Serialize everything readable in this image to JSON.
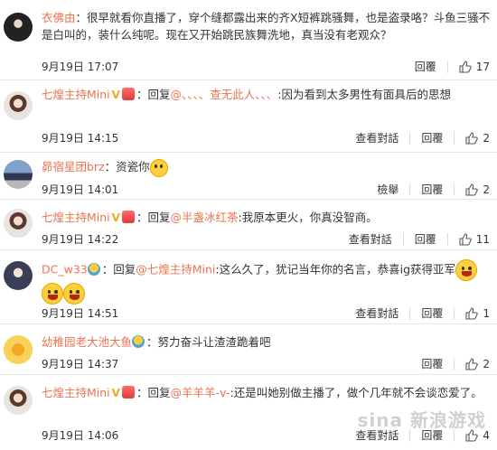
{
  "comments": [
    {
      "username": "衣佛由",
      "text": "：很早就看你直播了，穿个缝都露出来的齐X短裤跳骚舞，也是盗录咯？斗鱼三骚不是白叫的，装什么纯呢。现在又开始跳民族舞洗地，真当没有老观众？",
      "time": "9月19日 17:07",
      "reply_label": "回覆",
      "likes": "17"
    },
    {
      "username": "七煌主持Mini",
      "reply_prefix": "：回复",
      "mention": "@、、、、查无此人、、、",
      "text": ":因为看到太多男性有面具后的思想",
      "time": "9月19日 14:15",
      "view_label": "查看對話",
      "reply_label": "回覆",
      "likes": "2"
    },
    {
      "username": "昴宿星团brz",
      "text": "：资瓷你",
      "time": "9月19日 14:01",
      "report_label": "檢舉",
      "reply_label": "回覆",
      "likes": "2"
    },
    {
      "username": "七煌主持Mini",
      "reply_prefix": "：回复",
      "mention": "@半盏冰红茶",
      "text": ":我原本更火，你真没智商。",
      "time": "9月19日 14:22",
      "view_label": "查看對話",
      "reply_label": "回覆",
      "likes": "11"
    },
    {
      "username": "DC_w33",
      "reply_prefix": "：回复",
      "mention": "@七煌主持Mini",
      "text": ":这么久了，犹记当年你的名言，恭喜ig获得亚军",
      "time": "9月19日 14:51",
      "view_label": "查看對話",
      "reply_label": "回覆",
      "likes": "1"
    },
    {
      "username": "幼稚园老大池大鱼",
      "text": "：努力奋斗让渣渣跪着吧",
      "time": "9月19日 14:37",
      "reply_label": "回覆",
      "likes": "2"
    },
    {
      "username": "七煌主持Mini",
      "reply_prefix": "：回复",
      "mention": "@羊羊羊-v-",
      "text": ":还是叫她别做主播了，做个几年就不会谈恋爱了。",
      "time": "9月19日 14:06",
      "view_label": "查看對話",
      "reply_label": "回覆",
      "likes": "4"
    }
  ],
  "watermark": "sina 新浪游戏",
  "colors": {
    "accent": "#eb7350",
    "text": "#333333",
    "divider": "#e6e6e6"
  }
}
